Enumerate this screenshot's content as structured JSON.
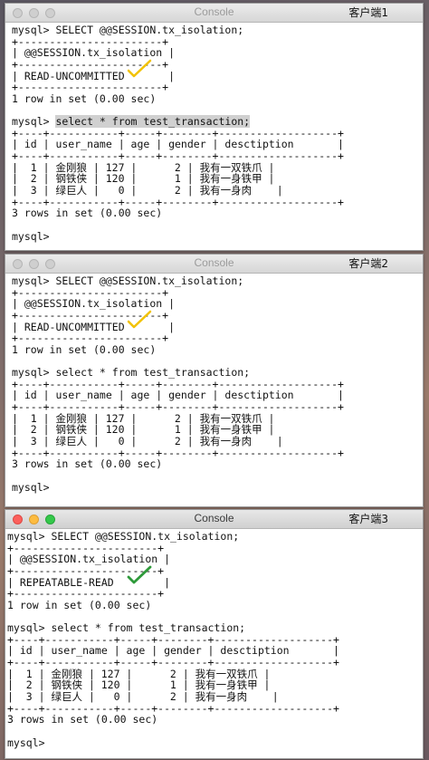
{
  "windows": [
    {
      "app_title": "Console",
      "client_label": "客户端1",
      "lines": [
        "mysql> SELECT @@SESSION.tx_isolation;",
        "+-----------------------+",
        "| @@SESSION.tx_isolation |",
        "+-----------------------+",
        "| READ-UNCOMMITTED       |",
        "+-----------------------+",
        "1 row in set (0.00 sec)",
        "",
        "mysql> select * from test_transaction;",
        "+----+-----------+-----+--------+-------------------+",
        "| id | user_name | age | gender | desctiption       |",
        "+----+-----------+-----+--------+-------------------+",
        "|  1 | 金刚狼 | 127 |      2 | 我有一双铁爪 |",
        "|  2 | 钢铁侠 | 120 |      1 | 我有一身铁甲 |",
        "|  3 | 绿巨人 |   0 |      2 | 我有一身肉    |",
        "+----+-----------+-----+--------+-------------------+",
        "3 rows in set (0.00 sec)",
        "",
        "mysql>"
      ],
      "highlighted_text": "select * from test_transaction;"
    },
    {
      "app_title": "Console",
      "client_label": "客户端2",
      "lines": [
        "mysql> SELECT @@SESSION.tx_isolation;",
        "+-----------------------+",
        "| @@SESSION.tx_isolation |",
        "+-----------------------+",
        "| READ-UNCOMMITTED       |",
        "+-----------------------+",
        "1 row in set (0.00 sec)",
        "",
        "mysql> select * from test_transaction;",
        "+----+-----------+-----+--------+-------------------+",
        "| id | user_name | age | gender | desctiption       |",
        "+----+-----------+-----+--------+-------------------+",
        "|  1 | 金刚狼 | 127 |      2 | 我有一双铁爪 |",
        "|  2 | 钢铁侠 | 120 |      1 | 我有一身铁甲 |",
        "|  3 | 绿巨人 |   0 |      2 | 我有一身肉    |",
        "+----+-----------+-----+--------+-------------------+",
        "3 rows in set (0.00 sec)",
        "",
        "mysql>"
      ]
    },
    {
      "app_title": "Console",
      "client_label": "客户端3",
      "lines": [
        "mysql> SELECT @@SESSION.tx_isolation;",
        "+-----------------------+",
        "| @@SESSION.tx_isolation |",
        "+-----------------------+",
        "| REPEATABLE-READ        |",
        "+-----------------------+",
        "1 row in set (0.00 sec)",
        "",
        "mysql> select * from test_transaction;",
        "+----+-----------+-----+--------+-------------------+",
        "| id | user_name | age | gender | desctiption       |",
        "+----+-----------+-----+--------+-------------------+",
        "|  1 | 金刚狼 | 127 |      2 | 我有一双铁爪 |",
        "|  2 | 钢铁侠 | 120 |      1 | 我有一身铁甲 |",
        "|  3 | 绿巨人 |   0 |      2 | 我有一身肉    |",
        "+----+-----------+-----+--------+-------------------+",
        "3 rows in set (0.00 sec)",
        "",
        "mysql>"
      ]
    }
  ],
  "colors": {
    "check_yellow": "#f2c200",
    "check_green": "#2e9a3a"
  }
}
